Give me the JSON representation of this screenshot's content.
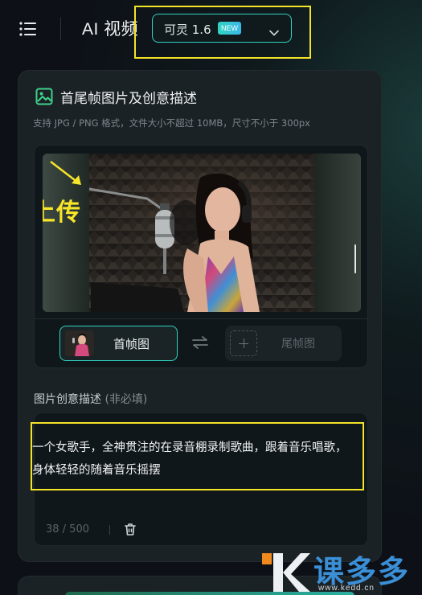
{
  "header": {
    "title": "AI 视频",
    "model_select": {
      "selected": "可灵 1.6",
      "badge": "NEW"
    }
  },
  "upload_card": {
    "title": "首尾帧图片及创意描述",
    "subtitle": "支持 JPG / PNG 格式，文件大小不超过 10MB，尺寸不小于 300px",
    "annotation": "上传",
    "first_frame_label": "首帧图",
    "last_frame_label": "尾帧图"
  },
  "description": {
    "label": "图片创意描述",
    "label_note": "(非必填)",
    "text": "一个女歌手，全神贯注的在录音棚录制歌曲，跟着音乐唱歌，身体轻轻的随着音乐摇摆",
    "counter": "38 / 500"
  },
  "watermark": {
    "text": "课多多",
    "url": "www.kedd.cn"
  },
  "colors": {
    "accent": "#2fd3c2",
    "highlight": "#f4e428",
    "background": "#0d1117",
    "card": "#1b2226"
  },
  "icons": {
    "menu": "menu-icon",
    "model_chevron": "chevron-down-icon",
    "card_title": "image-icon",
    "swap": "swap-icon",
    "add": "plus-icon",
    "clear": "trash-icon"
  }
}
